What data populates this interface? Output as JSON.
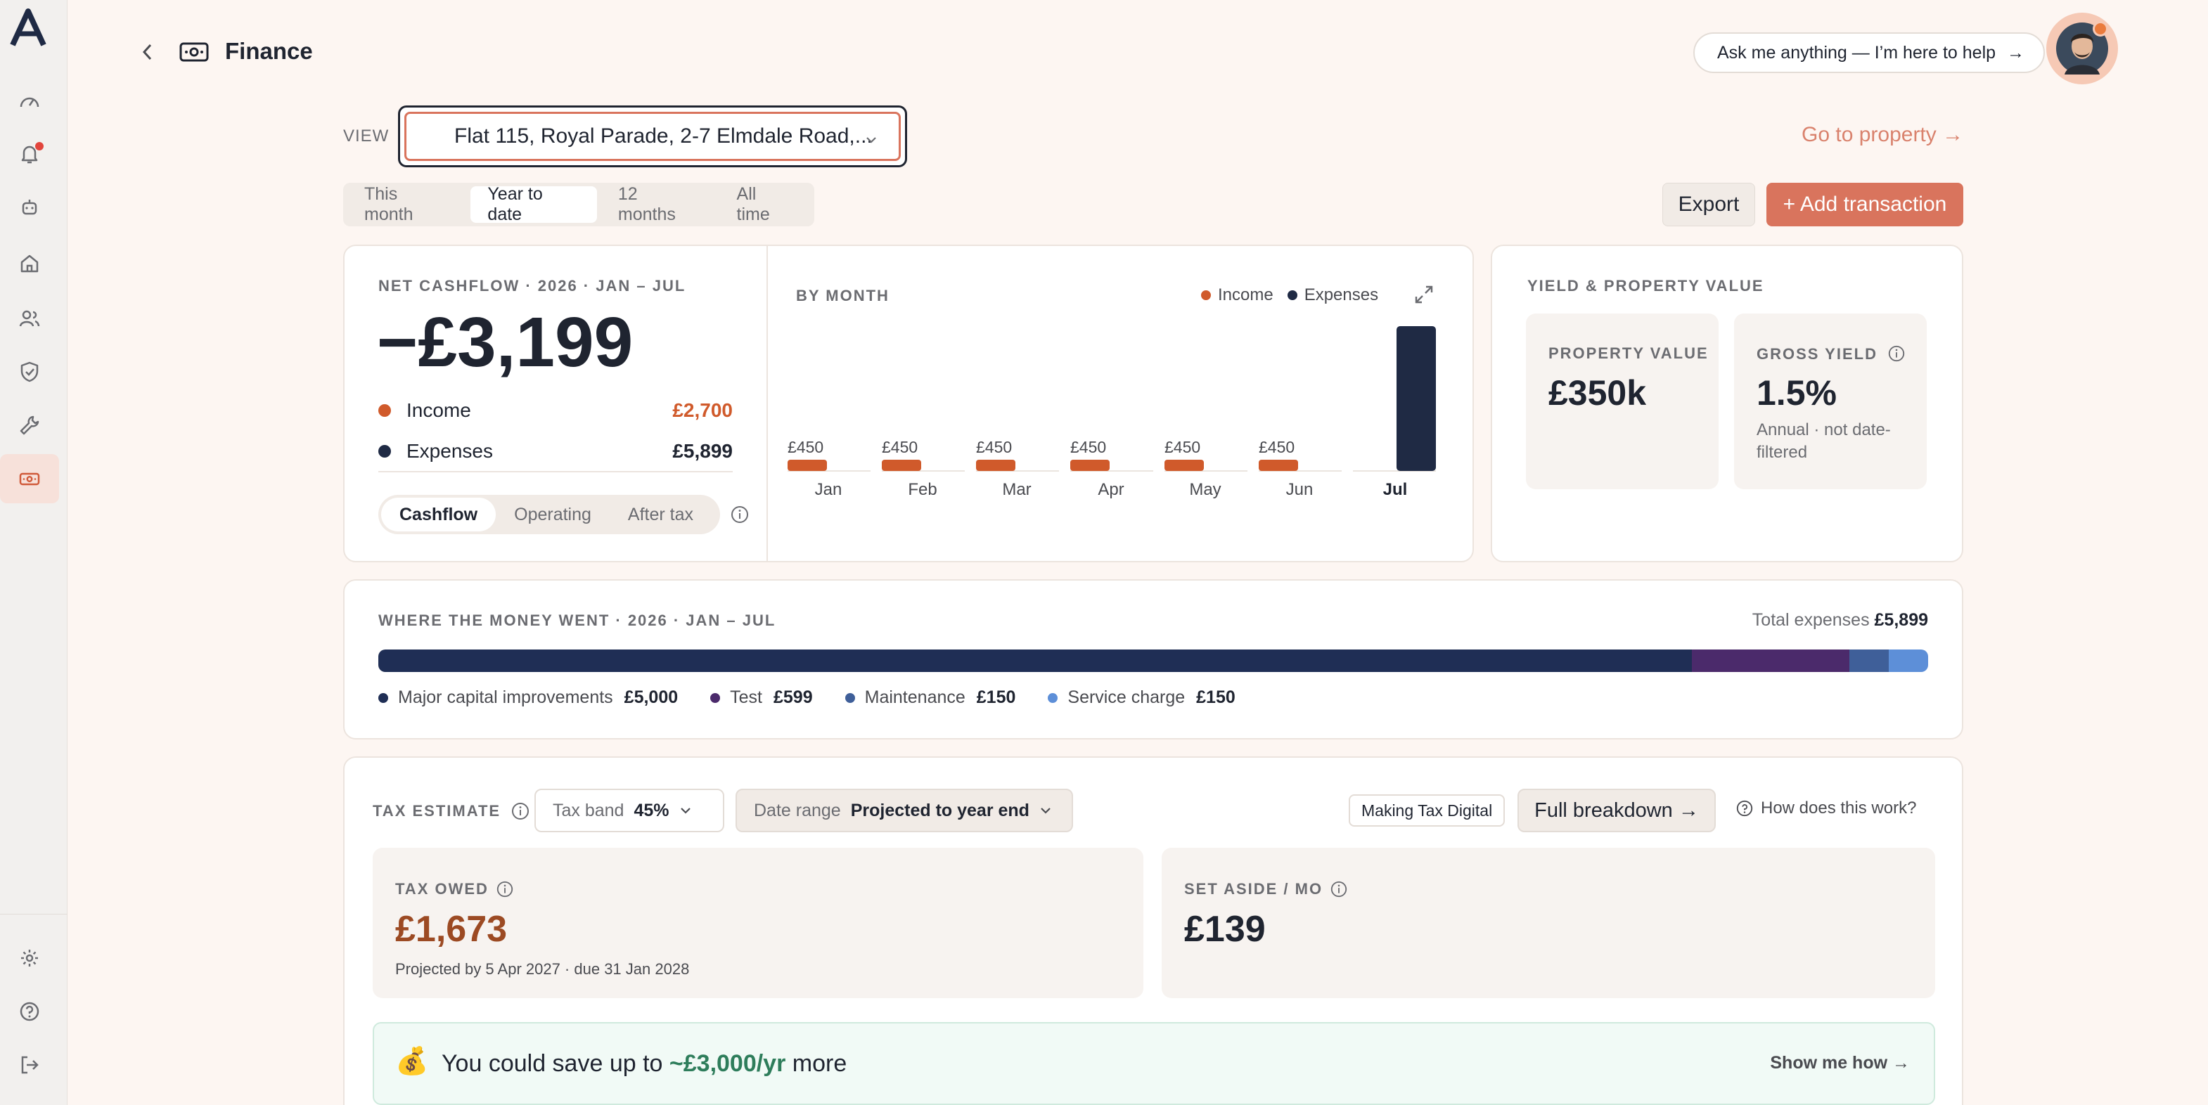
{
  "header": {
    "title": "Finance",
    "ask_placeholder": "Ask me anything — I’m here to help",
    "ask_arrow": "→"
  },
  "view": {
    "label": "VIEW",
    "selected_property": "Flat 115, Royal Parade, 2-7 Elmdale Road,...",
    "go_to_property": "Go to property →"
  },
  "period_tabs": [
    "This month",
    "Year to date",
    "12 months",
    "All time"
  ],
  "period_active": "Year to date",
  "actions": {
    "export": "Export",
    "add_transaction": "+ Add transaction"
  },
  "net_cashflow": {
    "label": "NET CASHFLOW · 2026 · JAN – JUL",
    "value": "−£3,199",
    "income_label": "Income",
    "income_value": "£2,700",
    "expenses_label": "Expenses",
    "expenses_value": "£5,899",
    "modes": [
      "Cashflow",
      "Operating",
      "After tax"
    ],
    "mode_active": "Cashflow"
  },
  "by_month": {
    "label": "BY MONTH",
    "legend_income": "Income",
    "legend_expenses": "Expenses"
  },
  "chart_data": {
    "type": "bar",
    "categories": [
      "Jan",
      "Feb",
      "Mar",
      "Apr",
      "May",
      "Jun",
      "Jul"
    ],
    "series": [
      {
        "name": "Income",
        "values": [
          450,
          450,
          450,
          450,
          450,
          450,
          0
        ],
        "color": "#d05a2b"
      },
      {
        "name": "Expenses",
        "values": [
          0,
          0,
          0,
          0,
          0,
          0,
          5899
        ],
        "color": "#1f2a44"
      }
    ],
    "data_labels": [
      "£450",
      "£450",
      "£450",
      "£450",
      "£450",
      "£450",
      ""
    ],
    "active_category": "Jul",
    "title": "BY MONTH"
  },
  "yield": {
    "label": "YIELD & PROPERTY VALUE",
    "property_value_label": "PROPERTY VALUE",
    "property_value": "£350k",
    "gross_yield_label": "GROSS YIELD",
    "gross_yield": "1.5%",
    "gross_yield_note": "Annual · not date-filtered"
  },
  "where_money_went": {
    "label": "WHERE THE MONEY WENT · 2026 · JAN – JUL",
    "total_label": "Total expenses",
    "total_value": "£5,899",
    "categories": [
      {
        "name": "Major capital improvements",
        "value": "£5,000",
        "amount": 5000,
        "color": "#1f2e55"
      },
      {
        "name": "Test",
        "value": "£599",
        "amount": 599,
        "color": "#4b2a6b"
      },
      {
        "name": "Maintenance",
        "value": "£150",
        "amount": 150,
        "color": "#3f5f99"
      },
      {
        "name": "Service charge",
        "value": "£150",
        "amount": 150,
        "color": "#5d8fd8"
      }
    ]
  },
  "tax": {
    "label": "TAX ESTIMATE",
    "band_label": "Tax band",
    "band_value": "45%",
    "range_label": "Date range",
    "range_value": "Projected to year end",
    "mtd": "Making Tax Digital",
    "full_breakdown": "Full breakdown →",
    "how_link": "How does this work?",
    "owed_label": "TAX OWED",
    "owed_value": "£1,673",
    "owed_note": "Projected by 5 Apr 2027 · due 31 Jan 2028",
    "aside_label": "SET ASIDE / MO",
    "aside_value": "£139",
    "owed_color": "#9c4a23"
  },
  "savings": {
    "emoji": "💰",
    "prefix": "You could save up to ",
    "highlight": "~£3,000/yr",
    "suffix": " more",
    "link": "Show me how →"
  }
}
